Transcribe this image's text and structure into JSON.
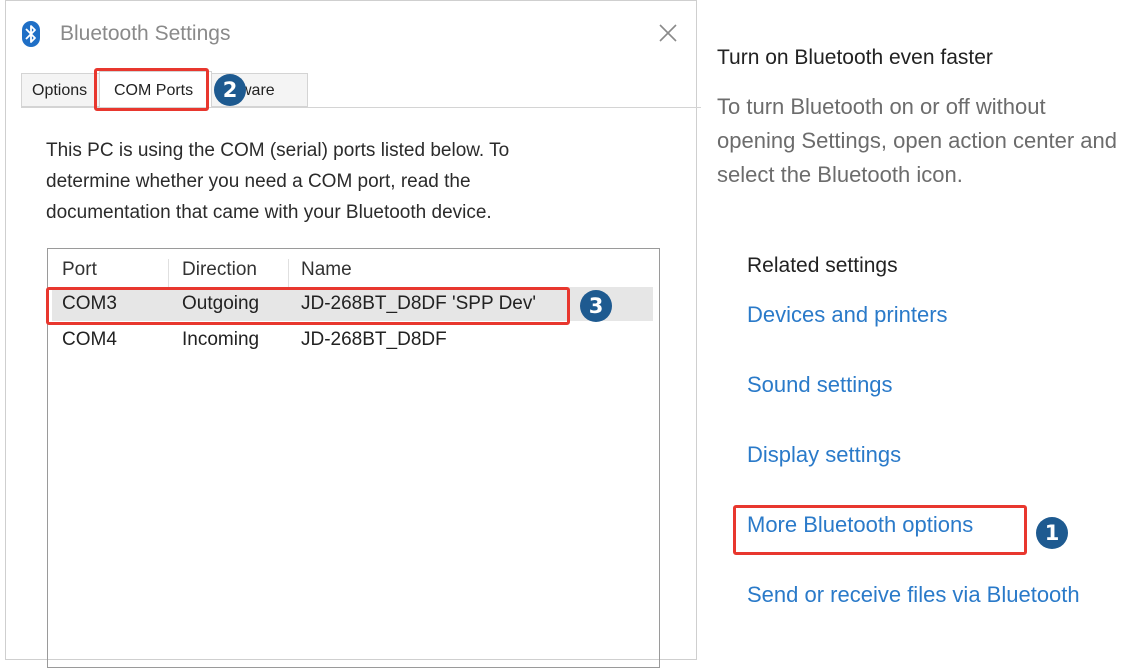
{
  "dialog": {
    "title": "Bluetooth Settings",
    "tabs": {
      "options": "Options",
      "com_ports": "COM Ports",
      "hardware": "ware"
    },
    "description": "This PC is using the COM (serial) ports listed below. To determine whether you need a COM port, read the documentation that came with your Bluetooth device.",
    "columns": {
      "port": "Port",
      "direction": "Direction",
      "name": "Name"
    },
    "rows": [
      {
        "port": "COM3",
        "direction": "Outgoing",
        "name": "JD-268BT_D8DF 'SPP Dev'"
      },
      {
        "port": "COM4",
        "direction": "Incoming",
        "name": "JD-268BT_D8DF"
      }
    ]
  },
  "side": {
    "tip_title": "Turn on Bluetooth even faster",
    "tip_body": "To turn Bluetooth on or off without opening Settings, open action center and select the Bluetooth icon.",
    "related_heading": "Related settings",
    "links": [
      "Devices and printers",
      "Sound settings",
      "Display settings",
      "More Bluetooth options",
      "Send or receive files via Bluetooth"
    ]
  },
  "annotations": {
    "step1": "1",
    "step2": "2",
    "step3": "3"
  },
  "icons": {
    "app": "bluetooth-icon",
    "close": "close-icon"
  },
  "colors": {
    "link": "#2a7ac9",
    "highlight": "#e8372e",
    "badge": "#1e5a90",
    "bluetooth": "#1f6fc6"
  }
}
